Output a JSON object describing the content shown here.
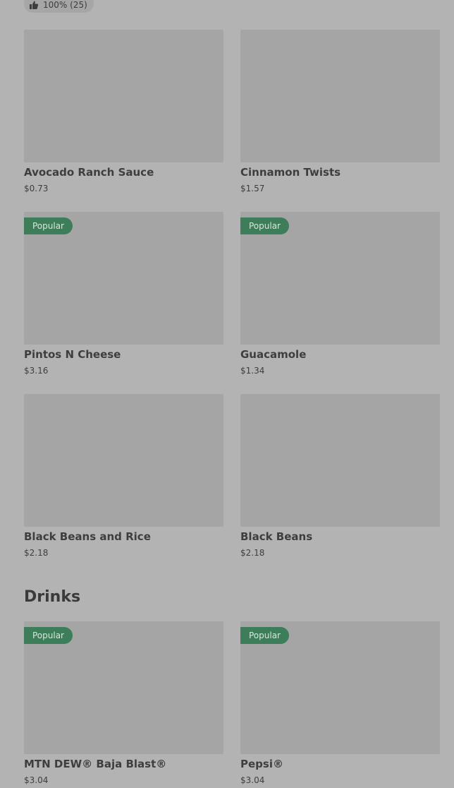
{
  "rating": {
    "text": "100% (25)",
    "icon": "thumbs-up-icon"
  },
  "sections": [
    {
      "title": "",
      "items": [
        {
          "name": "Avocado Ranch Sauce",
          "price": "$0.73",
          "badge": ""
        },
        {
          "name": "Cinnamon Twists",
          "price": "$1.57",
          "badge": ""
        },
        {
          "name": "Pintos N Cheese",
          "price": "$3.16",
          "badge": "Popular"
        },
        {
          "name": "Guacamole",
          "price": "$1.34",
          "badge": "Popular"
        },
        {
          "name": "Black Beans and Rice",
          "price": "$2.18",
          "badge": ""
        },
        {
          "name": "Black Beans",
          "price": "$2.18",
          "badge": ""
        }
      ]
    },
    {
      "title": "Drinks",
      "items": [
        {
          "name": "MTN DEW® Baja Blast®",
          "price": "$3.04",
          "badge": "Popular"
        },
        {
          "name": "Pepsi®",
          "price": "$3.04",
          "badge": "Popular"
        }
      ]
    }
  ],
  "colors": {
    "background": "#b3b3b3",
    "image_placeholder": "#a5a5a5",
    "badge": "#3e7d5a"
  }
}
